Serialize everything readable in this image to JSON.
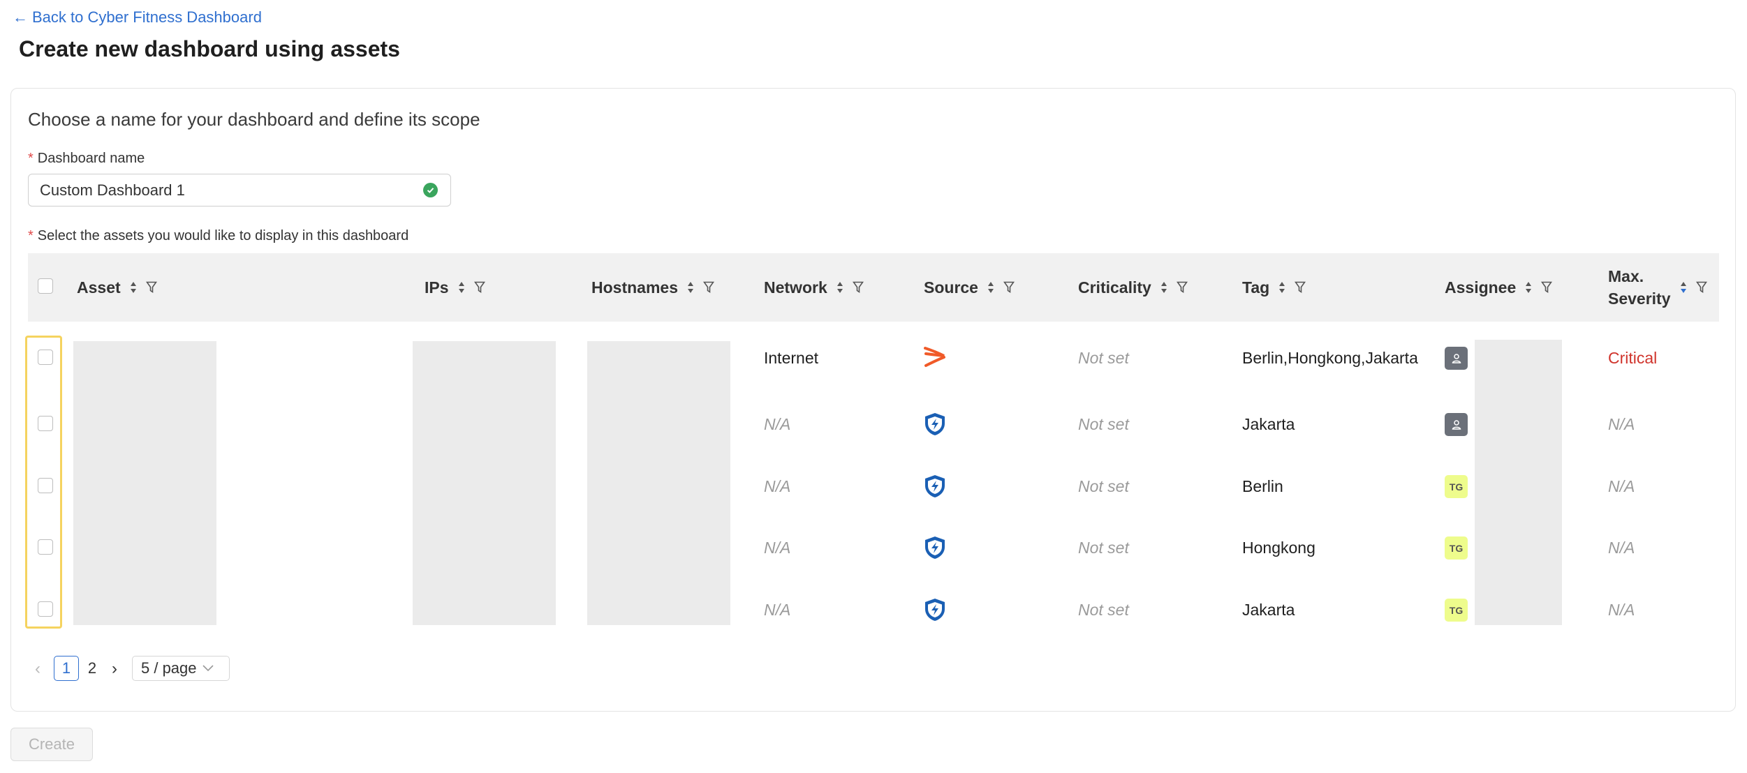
{
  "nav": {
    "back_label": "Back to Cyber Fitness Dashboard",
    "back_arrow": "←"
  },
  "page": {
    "title": "Create new dashboard using assets"
  },
  "form": {
    "section_title": "Choose a name for your dashboard and define its scope",
    "required_mark": "*",
    "dashboard_name_label": "Dashboard name",
    "dashboard_name_value": "Custom Dashboard 1",
    "assets_label": "Select the assets you would like to display in this dashboard"
  },
  "table": {
    "columns": [
      "Asset",
      "IPs",
      "Hostnames",
      "Network",
      "Source",
      "Criticality",
      "Tag",
      "Assignee",
      "Max.",
      "Severity"
    ],
    "rows": [
      {
        "network": "Internet",
        "source_icon": "source-logo-orange-icon",
        "criticality": "Not set",
        "tag": "Berlin,Hongkong,Jakarta",
        "assignee_icon": "user-avatar-icon",
        "severity": "Critical"
      },
      {
        "network": "N/A",
        "source_icon": "shield-bolt-icon",
        "criticality": "Not set",
        "tag": "Jakarta",
        "assignee_icon": "user-avatar-icon",
        "severity": "N/A"
      },
      {
        "network": "N/A",
        "source_icon": "shield-bolt-icon",
        "criticality": "Not set",
        "tag": "Berlin",
        "assignee_initials": "TG",
        "severity": "N/A"
      },
      {
        "network": "N/A",
        "source_icon": "shield-bolt-icon",
        "criticality": "Not set",
        "tag": "Hongkong",
        "assignee_initials": "TG",
        "severity": "N/A"
      },
      {
        "network": "N/A",
        "source_icon": "shield-bolt-icon",
        "criticality": "Not set",
        "tag": "Jakarta",
        "assignee_initials": "TG",
        "severity": "N/A"
      }
    ]
  },
  "pagination": {
    "pages": [
      "1",
      "2"
    ],
    "current": "1",
    "page_size": "5 / page",
    "prev": "‹",
    "next": "›"
  },
  "actions": {
    "create_label": "Create"
  },
  "colors": {
    "accent": "#2f6fcf",
    "critical": "#d0342c",
    "success": "#3aa55d",
    "highlight": "#f5d35f",
    "tag_avatar": "#eefc8c"
  }
}
